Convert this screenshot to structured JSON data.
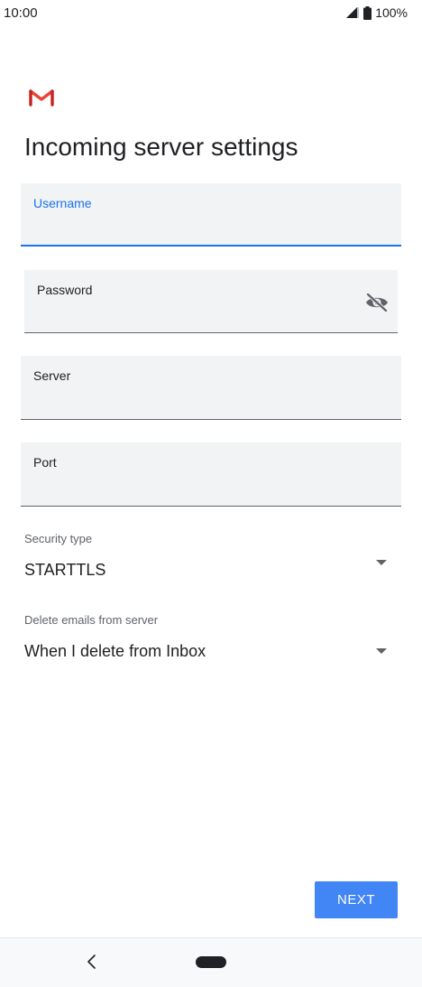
{
  "status_bar": {
    "time": "10:00",
    "battery": "100%",
    "icons": [
      "signal-icon",
      "battery-icon"
    ]
  },
  "app": {
    "logo": "gmail-logo"
  },
  "page": {
    "title": "Incoming server settings"
  },
  "fields": {
    "username": {
      "label": "Username",
      "value": "",
      "focused": true
    },
    "password": {
      "label": "Password",
      "value": "",
      "toggle_icon": "visibility-off-icon"
    },
    "server": {
      "label": "Server",
      "value": ""
    },
    "port": {
      "label": "Port",
      "value": ""
    }
  },
  "security_type": {
    "caption": "Security type",
    "selected": "STARTTLS",
    "icon": "dropdown-arrow-icon"
  },
  "delete_emails": {
    "caption": "Delete emails from server",
    "selected": "When I delete from Inbox",
    "icon": "dropdown-arrow-icon"
  },
  "actions": {
    "next_label": "NEXT"
  },
  "nav_bar": {
    "icons": [
      "back-icon",
      "home-pill-icon"
    ]
  },
  "colors": {
    "accent": "#1a73e8",
    "button": "#4285f4",
    "field_bg": "#f1f3f4",
    "gmail_red": "#ea4335"
  }
}
